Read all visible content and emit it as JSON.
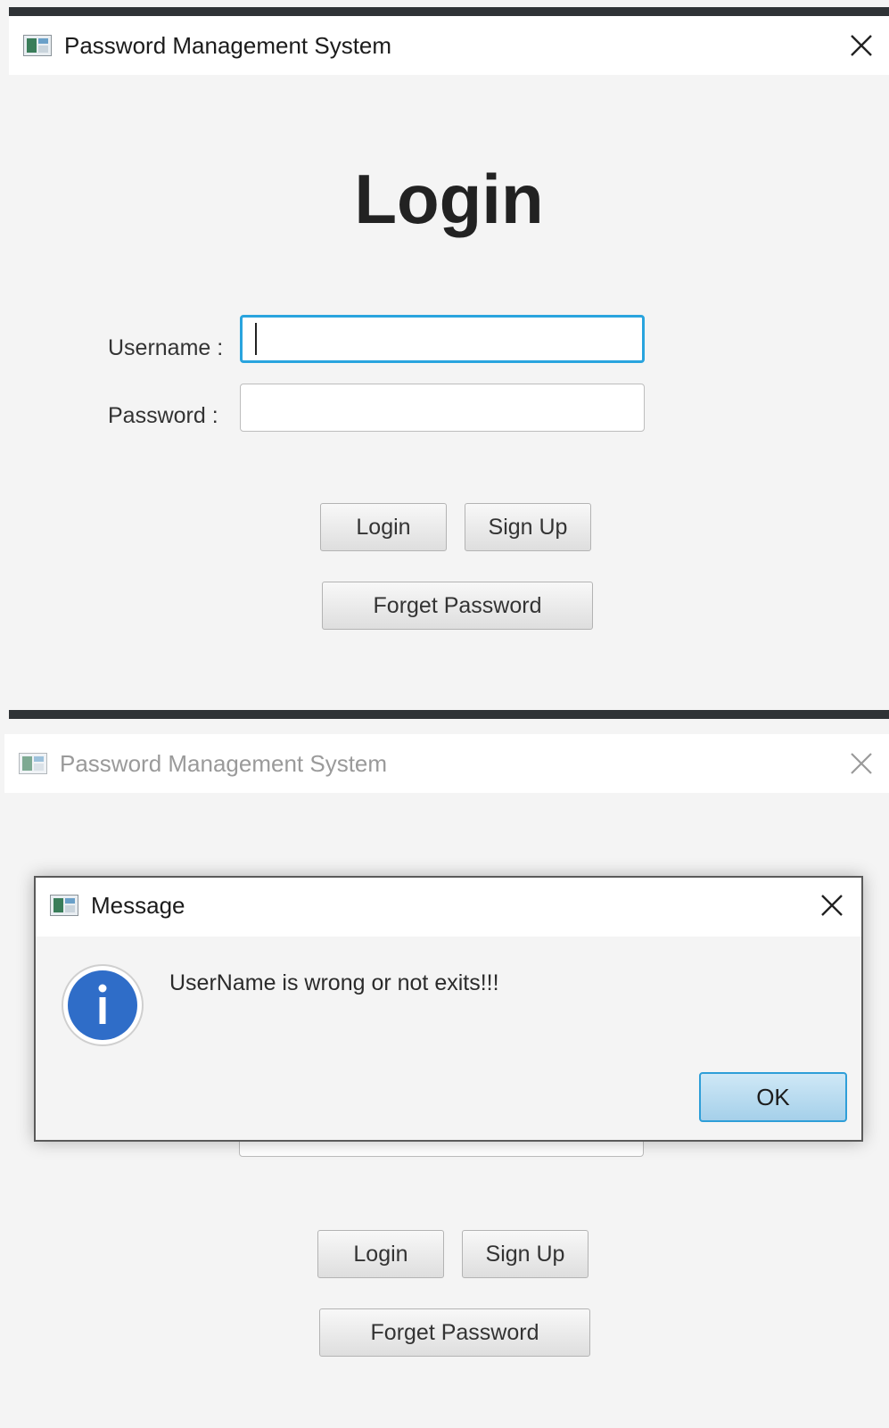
{
  "window": {
    "title": "Password Management System"
  },
  "login": {
    "heading": "Login",
    "username_label": "Username :",
    "password_label": "Password :",
    "username_value": "",
    "password_value": "",
    "buttons": {
      "login": "Login",
      "signup": "Sign Up",
      "forget": "Forget Password"
    }
  },
  "dialog": {
    "title": "Message",
    "message": "UserName is wrong or not exits!!!",
    "ok": "OK",
    "icon": "info-icon"
  },
  "colors": {
    "focus": "#29a4de",
    "info": "#2f6dc8",
    "bar": "#2f3336"
  }
}
